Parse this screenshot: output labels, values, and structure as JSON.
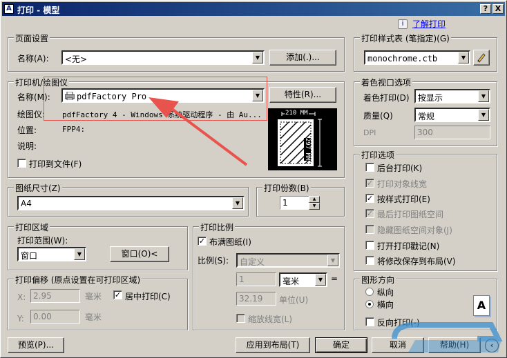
{
  "window": {
    "title": "打印 - 模型",
    "help_button": "?",
    "close_button": "X"
  },
  "help_link": "了解打印",
  "page_setup": {
    "group_label": "页面设置",
    "name_label": "名称(A):",
    "name_value": "<无>",
    "add_button": "添加(.)..."
  },
  "printer": {
    "group_label": "打印机/绘图仪",
    "name_label": "名称(M):",
    "name_value": "pdfFactory Pro",
    "properties_button": "特性(R)...",
    "plotter_label": "绘图仪:",
    "plotter_value": "pdfFactory 4 - Windows 系统驱动程序 - 由 Au...",
    "location_label": "位置:",
    "location_value": "FPP4:",
    "description_label": "说明:",
    "print_to_file_label": "打印到文件(F)",
    "preview_width": "210 MM",
    "preview_height": "297 MM"
  },
  "paper_size": {
    "group_label": "图纸尺寸(Z)",
    "value": "A4"
  },
  "copies": {
    "group_label": "打印份数(B)",
    "value": "1"
  },
  "plot_area": {
    "group_label": "打印区域",
    "range_label": "打印范围(W):",
    "range_value": "窗口",
    "window_button": "窗口(O)<"
  },
  "plot_scale": {
    "group_label": "打印比例",
    "fit_label": "布满图纸(I)",
    "scale_label": "比例(S):",
    "scale_value": "自定义",
    "value1": "1",
    "unit_value": "毫米",
    "equals": "=",
    "value2": "32.19",
    "unit_label": "单位(U)",
    "lineweights_label": "缩放线宽(L)"
  },
  "plot_offset": {
    "group_label": "打印偏移 (原点设置在可打印区域)",
    "x_label": "X:",
    "x_value": "2.95",
    "x_unit": "毫米",
    "center_label": "居中打印(C)",
    "y_label": "Y:",
    "y_value": "0.00",
    "y_unit": "毫米"
  },
  "plot_style_table": {
    "group_label": "打印样式表 (笔指定)(G)",
    "value": "monochrome.ctb"
  },
  "shaded_viewport": {
    "group_label": "着色视口选项",
    "shade_label": "着色打印(D)",
    "shade_value": "按显示",
    "quality_label": "质量(Q)",
    "quality_value": "常规",
    "dpi_label": "DPI",
    "dpi_value": "300"
  },
  "plot_options": {
    "group_label": "打印选项",
    "items": [
      {
        "label": "后台打印(K)",
        "checked": ""
      },
      {
        "label": "打印对象线宽",
        "checked": "✓"
      },
      {
        "label": "按样式打印(E)",
        "checked": "✓"
      },
      {
        "label": "最后打印图纸空间",
        "checked": "✓"
      },
      {
        "label": "隐藏图纸空间对象(J)",
        "checked": ""
      },
      {
        "label": "打开打印戳记(N)",
        "checked": ""
      },
      {
        "label": "将修改保存到布局(V)",
        "checked": ""
      }
    ]
  },
  "orientation": {
    "group_label": "图形方向",
    "portrait_label": "纵向",
    "landscape_label": "横向",
    "upside_down_label": "反向打印(-)",
    "icon_letter": "A"
  },
  "footer": {
    "preview_button": "预览(P)...",
    "apply_button": "应用到布局(T)",
    "ok_button": "确定",
    "cancel_button": "取消",
    "help_button": "帮助(H)"
  },
  "colors": {
    "title_start": "#0a246a",
    "title_end": "#3a6ea5",
    "annotation": "#e8534e"
  }
}
